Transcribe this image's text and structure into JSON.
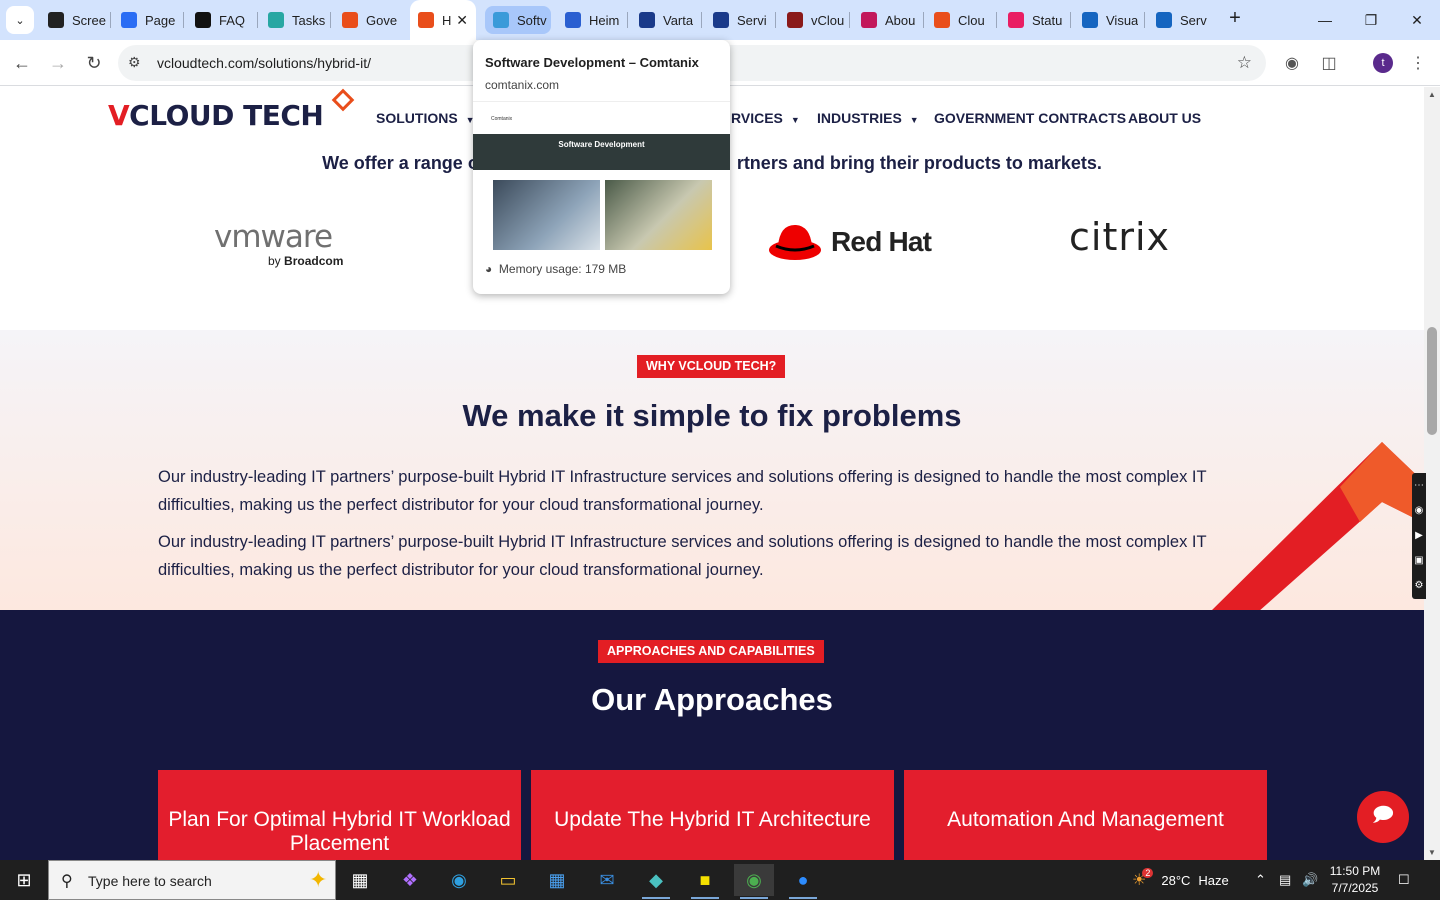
{
  "browser": {
    "tabs": [
      {
        "title": "Scree",
        "icon": "screencast-icon",
        "color": "#222222"
      },
      {
        "title": "Page",
        "icon": "pagespeed-icon",
        "color": "#2a6df4"
      },
      {
        "title": "FAQ",
        "icon": "openai-icon",
        "color": "#111111"
      },
      {
        "title": "Tasks",
        "icon": "tasks-icon",
        "color": "#27a7a3"
      },
      {
        "title": "Gove",
        "icon": "vcloud-gem-icon",
        "color": "#e94e1b"
      },
      {
        "title": "H",
        "icon": "vcloud-gem-icon",
        "color": "#e94e1b",
        "active": true
      },
      {
        "title": "Softv",
        "icon": "comtanix-icon",
        "color": "#3a9ad9",
        "hovered": true
      },
      {
        "title": "Heim",
        "icon": "scale-icon",
        "color": "#2a5fd1"
      },
      {
        "title": "Varta",
        "icon": "varta-icon",
        "color": "#1a3a8a"
      },
      {
        "title": "Servi",
        "icon": "swoosh-icon",
        "color": "#1a3a8a"
      },
      {
        "title": "vClou",
        "icon": "v-icon",
        "color": "#8a1a1a"
      },
      {
        "title": "Abou",
        "icon": "dots-icon",
        "color": "#c2185b"
      },
      {
        "title": "Clou",
        "icon": "slash-icon",
        "color": "#e94e1b"
      },
      {
        "title": "Statu",
        "icon": "status-icon",
        "color": "#e91e63"
      },
      {
        "title": "Visua",
        "icon": "pulse-icon",
        "color": "#1565c0"
      },
      {
        "title": "Serv",
        "icon": "doc-icon",
        "color": "#1565c0"
      }
    ],
    "url": "vcloudtech.com/solutions/hybrid-it/",
    "profile_initial": "t",
    "hover_card": {
      "title": "Software Development – Comtanix",
      "domain": "comtanix.com",
      "thumb_brand": "Comtanix",
      "thumb_heading": "Software Development",
      "memory": "Memory usage: 179 MB"
    }
  },
  "site": {
    "logo_v": "V",
    "logo_rest": "CLOUD TECH",
    "nav": [
      {
        "label": "SOLUTIONS",
        "caret": true
      },
      {
        "label": "RVICES",
        "caret": true
      },
      {
        "label": "INDUSTRIES",
        "caret": true
      },
      {
        "label": "GOVERNMENT CONTRACTS",
        "caret": false
      },
      {
        "label": "ABOUT US",
        "caret": false
      }
    ],
    "offer_left": "We offer a range o",
    "offer_right": "rtners and bring their products to markets.",
    "partners": {
      "vmware": "vmware",
      "vmware_by": "by",
      "vmware_broadcom": "Broadcom",
      "redhat": "Red Hat",
      "citrix": "citrix"
    },
    "why": {
      "badge": "WHY VCLOUD TECH?",
      "heading": "We make it simple to fix problems",
      "paragraphs": [
        "Our industry-leading IT partners’ purpose-built Hybrid IT Infrastructure services and solutions offering is designed to handle the most complex IT difficulties, making us the perfect distributor for your cloud transformational journey.",
        "Our industry-leading IT partners’ purpose-built Hybrid IT Infrastructure services and solutions offering is designed to handle the most complex IT difficulties, making us the perfect distributor for your cloud transformational journey."
      ]
    },
    "approaches": {
      "badge": "APPROACHES AND CAPABILITIES",
      "heading": "Our Approaches",
      "cards": [
        "Plan For Optimal Hybrid IT Workload Placement",
        "Update The Hybrid IT Architecture",
        "Automation And Management"
      ]
    }
  },
  "taskbar": {
    "search_placeholder": "Type here to search",
    "weather_temp": "28°C",
    "weather_desc": "Haze",
    "weather_badge": "2",
    "time": "11:50 PM",
    "date": "7/7/2025"
  },
  "colors": {
    "brand_red": "#e31e24",
    "brand_navy": "#1c2045",
    "section_dark": "#15173f",
    "accent_orange": "#e94e1b"
  }
}
